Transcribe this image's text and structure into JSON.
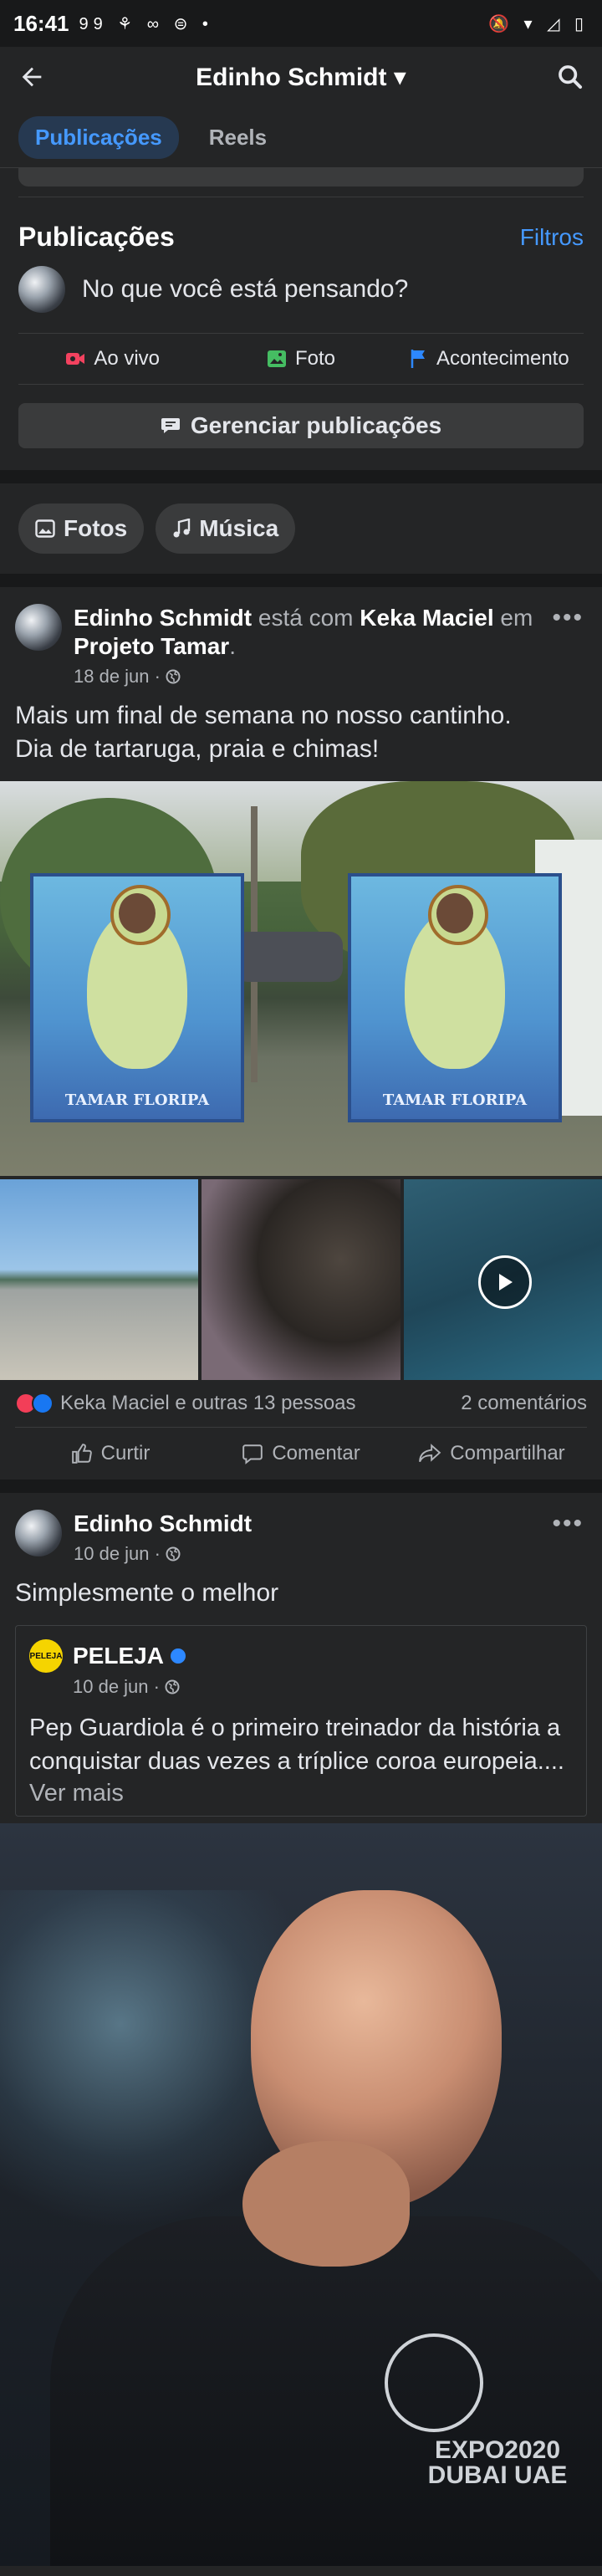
{
  "status_bar": {
    "time": "16:41",
    "notif_icons": "99 ⚘ ∞ ⊜ •",
    "system_icons": "🔕 ▾ ◿ ▯"
  },
  "app_bar": {
    "title": "Edinho Schmidt ▾"
  },
  "tabs": [
    {
      "label": "Publicações",
      "active": true
    },
    {
      "label": "Reels",
      "active": false
    }
  ],
  "publications": {
    "heading": "Publicações",
    "filters_label": "Filtros",
    "composer_placeholder": "No que você está pensando?",
    "actions": [
      {
        "label": "Ao vivo",
        "icon": "live-video-icon",
        "color": "#f3425f"
      },
      {
        "label": "Foto",
        "icon": "photo-icon",
        "color": "#45bd62"
      },
      {
        "label": "Acontecimento",
        "icon": "flag-icon",
        "color": "#2d88ff"
      }
    ],
    "manage_label": "Gerenciar publicações"
  },
  "chips": [
    {
      "label": "Fotos",
      "icon": "photo-icon"
    },
    {
      "label": "Música",
      "icon": "music-note-icon"
    }
  ],
  "post1": {
    "author": "Edinho Schmidt",
    "with_text": " está com ",
    "tagged": "Keka Maciel",
    "at_text": " em ",
    "place": "Projeto Tamar",
    "period": ".",
    "date": "18 de jun · ",
    "text": "Mais um final de semana no nosso cantinho.\nDia de tartaruga, praia e chimas!",
    "board_label": "TAMAR FLORIPA",
    "reactions_text": "Keka Maciel e outras 13 pessoas",
    "comments_text": "2 comentários",
    "actions": [
      "Curtir",
      "Comentar",
      "Compartilhar"
    ]
  },
  "post2": {
    "author": "Edinho Schmidt",
    "date": "10 de jun · ",
    "text": "Simplesmente o melhor",
    "shared": {
      "page_name": "PELEJA",
      "logo_text": "PELEJA",
      "date": "10 de jun · ",
      "text": "Pep Guardiola é o primeiro treinador da história a conquistar duas vezes a tríplice coroa europeia....",
      "more": "Ver mais"
    },
    "photo_text": "EXPO2020 DUBAI UAE"
  }
}
